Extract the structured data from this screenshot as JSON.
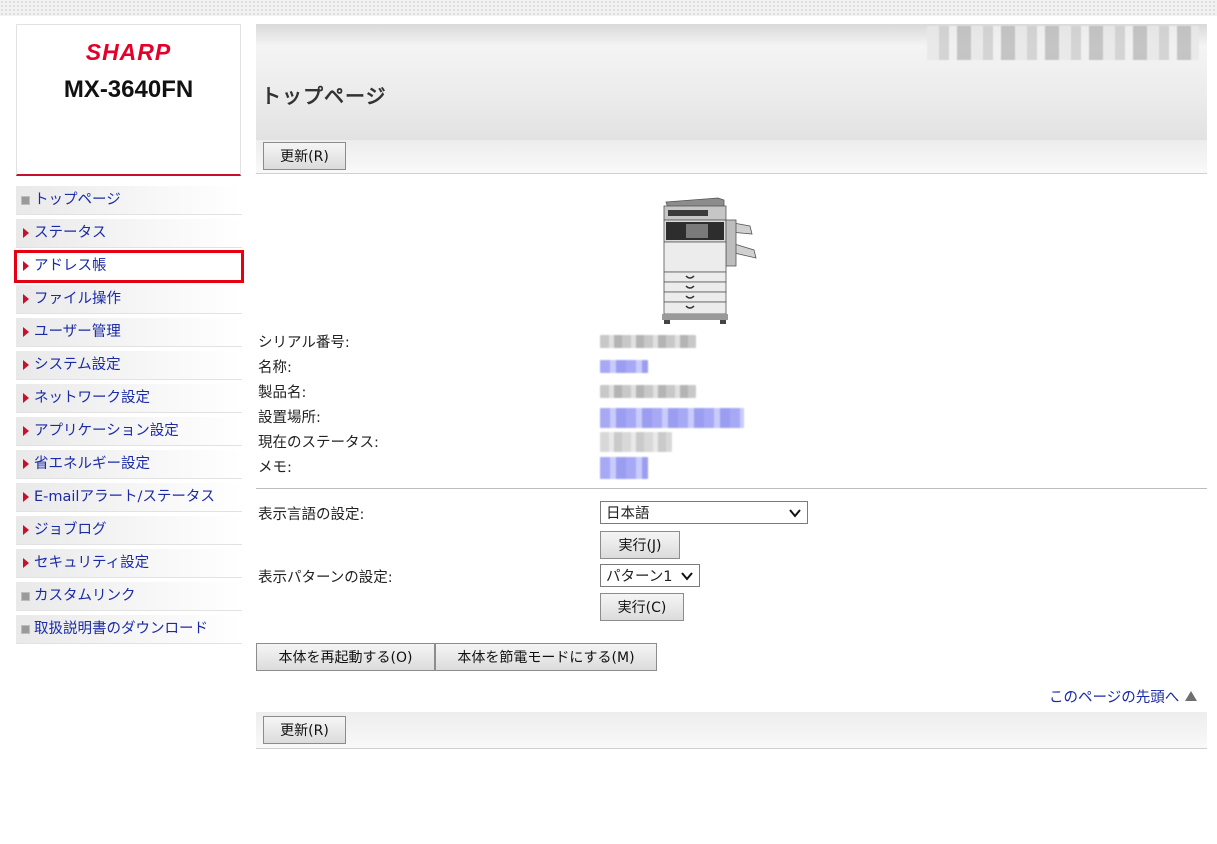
{
  "brand": {
    "logo_text": "SHARP",
    "model": "MX-3640FN"
  },
  "header": {
    "title": "トップページ",
    "user_info_redacted": true
  },
  "toolbar": {
    "refresh_label": "更新(R)"
  },
  "sidebar": {
    "items": [
      {
        "label": "トップページ",
        "icon": "square-bullet-icon"
      },
      {
        "label": "ステータス",
        "icon": "triangle-right-icon"
      },
      {
        "label": "アドレス帳",
        "icon": "triangle-right-icon",
        "selected": true
      },
      {
        "label": "ファイル操作",
        "icon": "triangle-right-icon"
      },
      {
        "label": "ユーザー管理",
        "icon": "triangle-right-icon"
      },
      {
        "label": "システム設定",
        "icon": "triangle-right-icon"
      },
      {
        "label": "ネットワーク設定",
        "icon": "triangle-right-icon"
      },
      {
        "label": "アプリケーション設定",
        "icon": "triangle-right-icon"
      },
      {
        "label": "省エネルギー設定",
        "icon": "triangle-right-icon"
      },
      {
        "label": "E-mailアラート/ステータス",
        "icon": "triangle-right-icon"
      },
      {
        "label": "ジョブログ",
        "icon": "triangle-right-icon"
      },
      {
        "label": "セキュリティ設定",
        "icon": "triangle-right-icon"
      },
      {
        "label": "カスタムリンク",
        "icon": "square-bullet-icon"
      },
      {
        "label": "取扱説明書のダウンロード",
        "icon": "square-bullet-icon"
      }
    ]
  },
  "info": {
    "serial_label": "シリアル番号:",
    "name_label": "名称:",
    "product_label": "製品名:",
    "location_label": "設置場所:",
    "status_label": "現在のステータス:",
    "memo_label": "メモ:"
  },
  "settings": {
    "language_label": "表示言語の設定:",
    "language_value": "日本語",
    "language_exec": "実行(J)",
    "pattern_label": "表示パターンの設定:",
    "pattern_value": "パターン1",
    "pattern_exec": "実行(C)"
  },
  "actions": {
    "reboot_label": "本体を再起動する(O)",
    "power_save_label": "本体を節電モードにする(M)"
  },
  "footer": {
    "page_top_label": "このページの先頭へ"
  },
  "colors": {
    "brand_red": "#e4002b",
    "link_blue": "#1a2aa8",
    "highlight_red": "#e60012"
  }
}
